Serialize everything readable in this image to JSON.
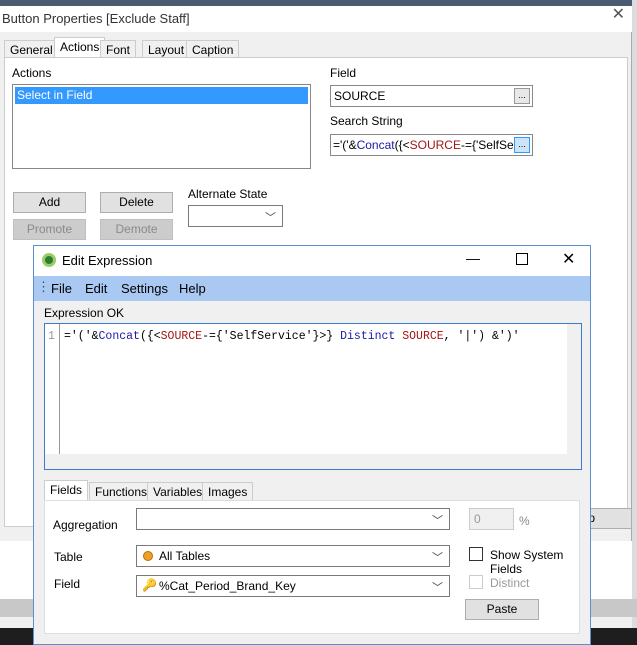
{
  "outer": {
    "title": "Button Properties [Exclude Staff]",
    "tabs": [
      "General",
      "Actions",
      "Font",
      "Layout",
      "Caption"
    ],
    "active_tab": "Actions",
    "actions_label": "Actions",
    "actions": [
      "Select in Field"
    ],
    "field_label": "Field",
    "field_value": "SOURCE",
    "search_label": "Search String",
    "search_parts": [
      "='('&",
      "Concat",
      "({<",
      "SOURCE",
      "-={'SelfSe"
    ],
    "add": "Add",
    "delete": "Delete",
    "promote": "Promote",
    "demote": "Demote",
    "alt_state_label": "Alternate State",
    "alt_state_value": "",
    "partial_button": "p",
    "dots": "..."
  },
  "editor": {
    "title": "Edit Expression",
    "menu": [
      "File",
      "Edit",
      "Settings",
      "Help"
    ],
    "status": "Expression OK",
    "line_number": "1",
    "expr_parts": [
      "='('&",
      "Concat",
      "({<",
      "SOURCE",
      "-={'SelfService'}>} ",
      "Distinct",
      " ",
      "SOURCE",
      ", '|') &')'"
    ],
    "tabs": [
      "Fields",
      "Functions",
      "Variables",
      "Images"
    ],
    "active_tab": "Fields",
    "aggregation_label": "Aggregation",
    "aggregation_value": "",
    "percent_value": "0",
    "percent_sign": "%",
    "table_label": "Table",
    "table_value": "All Tables",
    "field_label": "Field",
    "field_value": "%Cat_Period_Brand_Key",
    "show_system_fields": "Show System Fields",
    "show_system_fields_checked": false,
    "distinct": "Distinct",
    "distinct_checked": false,
    "paste": "Paste"
  },
  "colors": {
    "selection": "#3399ff",
    "menubar": "#a9c9f3",
    "keyword_blue": "#1a1aa6",
    "field_red": "#a31515"
  }
}
